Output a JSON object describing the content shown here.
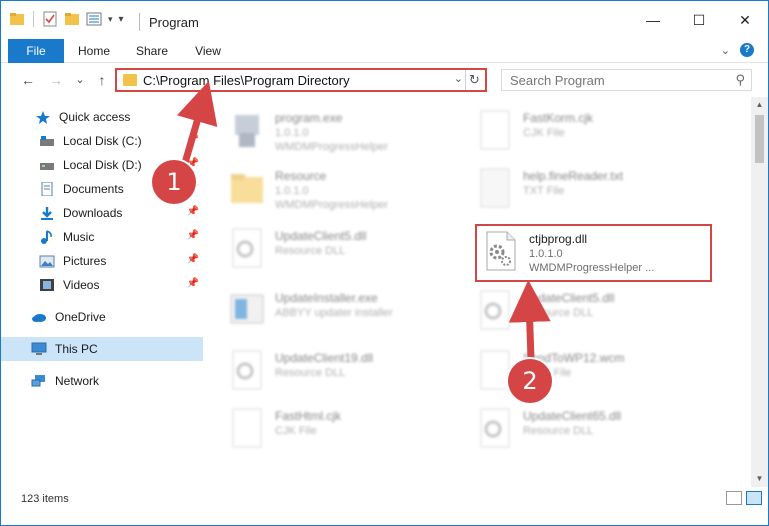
{
  "window": {
    "title": "Program",
    "buttons": {
      "minimize": "—",
      "maximize": "☐",
      "close": "✕"
    }
  },
  "ribbon": {
    "tabs": [
      "File",
      "Home",
      "Share",
      "View"
    ],
    "help": "?"
  },
  "navigation": {
    "back": "←",
    "forward": "→",
    "recent": "⌄",
    "up": "↑",
    "address_path": "C:\\Program Files\\Program Directory",
    "search_placeholder": "Search Program"
  },
  "sidebar": {
    "items": [
      {
        "label": "Quick access",
        "icon": "star-icon",
        "pinned": false
      },
      {
        "label": "Local Disk (C:)",
        "icon": "drive-icon",
        "pinned": true
      },
      {
        "label": "Local Disk (D:)",
        "icon": "drive-icon",
        "pinned": true
      },
      {
        "label": "Documents",
        "icon": "documents-icon",
        "pinned": true
      },
      {
        "label": "Downloads",
        "icon": "download-icon",
        "pinned": true
      },
      {
        "label": "Music",
        "icon": "music-icon",
        "pinned": true
      },
      {
        "label": "Pictures",
        "icon": "pictures-icon",
        "pinned": true
      },
      {
        "label": "Videos",
        "icon": "videos-icon",
        "pinned": true
      },
      {
        "label": "OneDrive",
        "icon": "cloud-icon",
        "pinned": false
      },
      {
        "label": "This PC",
        "icon": "computer-icon",
        "pinned": false,
        "selected": true
      },
      {
        "label": "Network",
        "icon": "network-icon",
        "pinned": false
      }
    ]
  },
  "files": {
    "left_column": [
      {
        "name": "program.exe",
        "type": "1.0.1.0",
        "desc": "WMDMProgressHelper"
      },
      {
        "name": "Resource",
        "type": "1.0.1.0",
        "desc": "WMDMProgressHelper"
      },
      {
        "name": "UpdateClient5.dll",
        "type": "Resource DLL",
        "desc": ""
      },
      {
        "name": "UpdateInstaller.exe",
        "type": "ABBYY updater installer",
        "desc": ""
      },
      {
        "name": "UpdateClient19.dll",
        "type": "Resource DLL",
        "desc": ""
      },
      {
        "name": "FastHtml.cjk",
        "type": "CJK File",
        "desc": ""
      }
    ],
    "right_column": [
      {
        "name": "FastKorm.cjk",
        "type": "CJK File",
        "desc": ""
      },
      {
        "name": "help.fineReader.txt",
        "type": "TXT File",
        "desc": ""
      },
      {
        "name": "UpdateClient5.dll",
        "type": "Resource DLL",
        "desc": ""
      },
      {
        "name": "SendToWP12.wcm",
        "type": "WCM File",
        "desc": ""
      },
      {
        "name": "UpdateClient65.dll",
        "type": "Resource DLL",
        "desc": ""
      }
    ],
    "highlighted": {
      "name": "ctjbprog.dll",
      "type": "1.0.1.0",
      "desc": "WMDMProgressHelper ..."
    }
  },
  "status": {
    "item_count": "123 items"
  },
  "callouts": {
    "step1": "1",
    "step2": "2"
  },
  "colors": {
    "accent": "#1979ca",
    "callout": "#d64545",
    "folder": "#f3c24a"
  }
}
